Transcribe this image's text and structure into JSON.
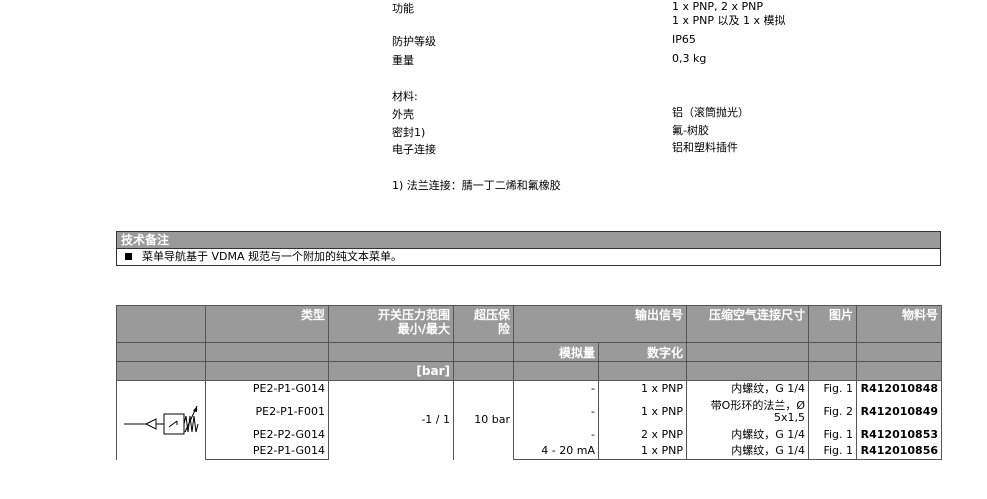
{
  "specs": {
    "function": {
      "label": "功能",
      "values": [
        "1 x PNP, 2 x PNP",
        "1 x PNP 以及 1 x 模拟"
      ]
    },
    "protection": {
      "label": "防护等级",
      "value": "IP65"
    },
    "weight": {
      "label": "重量",
      "value": "0,3 kg"
    },
    "materials_heading": "材料:",
    "housing": {
      "label": "外壳",
      "value": "铝（滚筒抛光）"
    },
    "seal": {
      "label": "密封1)",
      "value": "氟-树胶"
    },
    "electrical": {
      "label": "电子连接",
      "value": "铝和塑料插件"
    },
    "footnote": "1) 法兰连接：腈一丁二烯和氟橡胶"
  },
  "notes": {
    "title": "技术备注",
    "item": "菜单导航基于 VDMA 规范与一个附加的纯文本菜单。"
  },
  "table": {
    "headers": {
      "type": "类型",
      "pressure_range": "开关压力范围 最小/最大",
      "overpressure": "超压保险",
      "output_signal": "输出信号",
      "connection": "压缩空气连接尺寸",
      "figure": "图片",
      "part_no": "物料号",
      "analog": "模拟量",
      "digital": "数字化",
      "unit": "[bar]"
    },
    "range_value": "-1 / 1",
    "overpressure_value": "10 bar",
    "symbol": "pressure-switch-symbol-icon",
    "rows": [
      {
        "type": "PE2-P1-G014",
        "analog": "-",
        "digital": "1 x PNP",
        "connection": "内螺纹，G 1/4",
        "figure": "Fig. 1",
        "part": "R412010848"
      },
      {
        "type": "PE2-P1-F001",
        "analog": "-",
        "digital": "1 x PNP",
        "connection": "带O形环的法兰，Ø 5x1,5",
        "figure": "Fig. 2",
        "part": "R412010849"
      },
      {
        "type": "PE2-P2-G014",
        "analog": "-",
        "digital": "2 x PNP",
        "connection": "内螺纹，G 1/4",
        "figure": "Fig. 1",
        "part": "R412010853"
      },
      {
        "type": "PE2-P1-G014",
        "analog": "4 - 20 mA",
        "digital": "1 x PNP",
        "connection": "内螺纹，G 1/4",
        "figure": "Fig. 1",
        "part": "R412010856"
      }
    ]
  },
  "colors": {
    "header_bg": "#9a9a9a",
    "header_text": "#ffffff"
  }
}
